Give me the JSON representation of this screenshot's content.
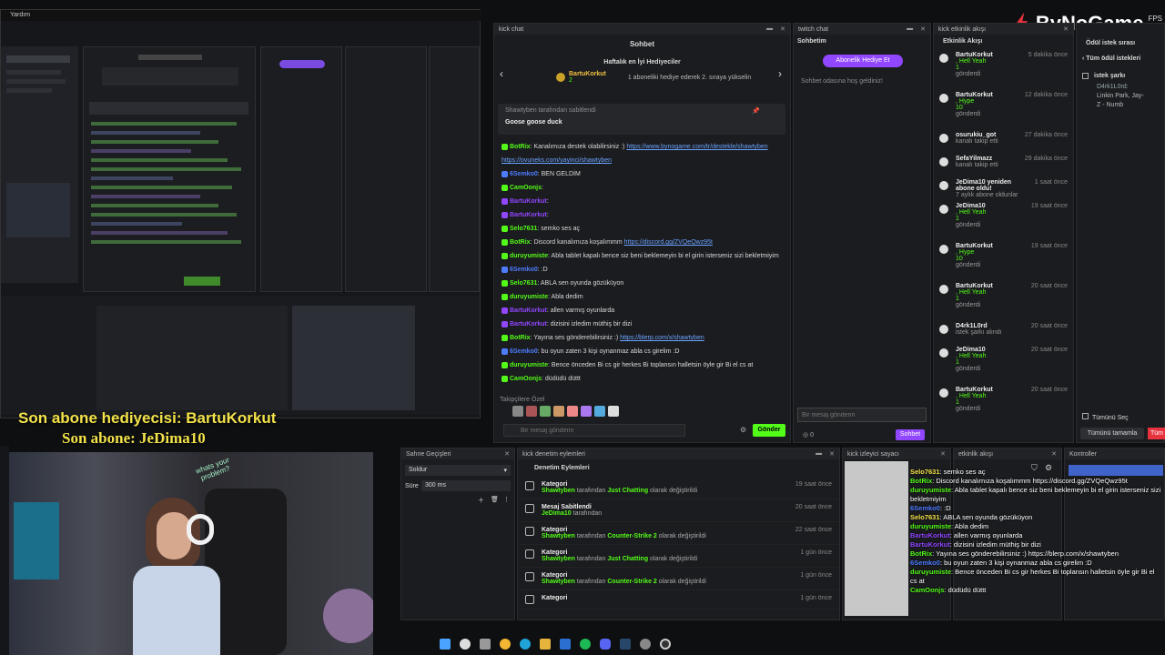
{
  "left_menu": {
    "item": "Yardım"
  },
  "brand": {
    "logo": "ByNoGame",
    "fps": "FPS",
    "accent": "#e8333f"
  },
  "kick_chat": {
    "title": "kick chat",
    "header": "Sohbet",
    "top_gifters_label": "Haftalık en İyi Hediyeciler",
    "top_gifter_name": "BartuKorkut",
    "top_gifter_count": "2",
    "top_gifter_note": "1 aboneliki hediye ederek 2. sıraya yükselin",
    "pinned_by": "Shawtyben tarafından sabitlendi",
    "pinned_message": "Goose goose duck",
    "messages": [
      {
        "user": "BotRix",
        "color": "#53fc18",
        "text": ": Kanalımıza destek olabilirsiniz :) ",
        "link": "https://www.bynogame.com/tr/destekle/shawtyben"
      },
      {
        "user": "",
        "color": "#6aa3ff",
        "text": "",
        "link": "https://ovuneks.com/yayinci/shawtyben"
      },
      {
        "user": "6Semko0",
        "color": "#4d7cff",
        "text": ": BEN GELDİM",
        "link": ""
      },
      {
        "user": "CamOonjs",
        "color": "#53fc18",
        "text": ": ",
        "link": ""
      },
      {
        "user": "BartuKorkut",
        "color": "#9146ff",
        "text": ": ",
        "link": ""
      },
      {
        "user": "BartuKorkut",
        "color": "#9146ff",
        "text": ": ",
        "link": ""
      },
      {
        "user": "Selo7631",
        "color": "#53fc18",
        "text": ": semko ses aç",
        "link": ""
      },
      {
        "user": "BotRix",
        "color": "#53fc18",
        "text": ": Discord kanalımıza koşalımmm ",
        "link": "https://discord.gg/ZVQeQwz95t"
      },
      {
        "user": "duruyumiste",
        "color": "#53fc18",
        "text": ": Abla tablet kapalı bence siz beni beklemeyin bi el girin isterseniz sizi bekletmiyim",
        "link": ""
      },
      {
        "user": "6Semko0",
        "color": "#4d7cff",
        "text": ": :D",
        "link": ""
      },
      {
        "user": "Selo7631",
        "color": "#53fc18",
        "text": ": ABLA sen oyunda gözüküyon",
        "link": ""
      },
      {
        "user": "duruyumiste",
        "color": "#53fc18",
        "text": ": Abla dedim",
        "link": ""
      },
      {
        "user": "BartuKorkut",
        "color": "#9146ff",
        "text": ": allen varmış oyunlarda",
        "link": ""
      },
      {
        "user": "BartuKorkut",
        "color": "#9146ff",
        "text": ": dizisini izledim müthiş bir dizi",
        "link": ""
      },
      {
        "user": "BotRix",
        "color": "#53fc18",
        "text": ": Yayına ses gönderebilirsiniz :) ",
        "link": "https://blerp.com/x/shawtyben"
      },
      {
        "user": "6Semko0",
        "color": "#4d7cff",
        "text": ": bu oyun zaten 3 kişi oynanmaz abla cs girelim :D",
        "link": ""
      },
      {
        "user": "duruyumiste",
        "color": "#53fc18",
        "text": ": Bence önceden Bi cs gir herkes Bi toplansın halletsin öyle gir Bi el cs at",
        "link": ""
      },
      {
        "user": "CamOonjs",
        "color": "#53fc18",
        "text": ": düdüdü düttt",
        "link": ""
      }
    ],
    "emote_label": "Takipçilere Özel",
    "input_placeholder": "Bir mesaj gönderin",
    "send_label": "Gönder"
  },
  "twitch_chat": {
    "title": "twitch chat",
    "header": "Sohbetim",
    "gift_button": "Abonelik Hediye Et",
    "welcome": "Sohbet odasına hoş geldiniz!",
    "input_placeholder": "Bir mesaj gönderin",
    "points": "0",
    "send_label": "Sohbet"
  },
  "activity": {
    "title": "kick etkinlik akışı",
    "header": "Etkinlik Akışı",
    "events": [
      {
        "name": "BartuKorkut",
        "lines": [
          ", Hell Yeah",
          "1",
          "gönderdi"
        ],
        "time": "5 dakika önce"
      },
      {
        "name": "BartuKorkut",
        "lines": [
          ", Hype",
          "10",
          "gönderdi"
        ],
        "time": "12 dakika önce"
      },
      {
        "name": "osurukiu_got",
        "lines": [
          "kanalı takip etti"
        ],
        "time": "27 dakika önce"
      },
      {
        "name": "SefaYilmazz",
        "lines": [
          "kanalı takip etti"
        ],
        "time": "29 dakika önce"
      },
      {
        "name": "JeDima10 yeniden abone oldu!",
        "lines": [
          "7 aylık abone oldunlar"
        ],
        "time": "1 saat önce"
      },
      {
        "name": "JeDima10",
        "lines": [
          ", Hell Yeah",
          "1",
          "gönderdi"
        ],
        "time": "19 saat önce"
      },
      {
        "name": "BartuKorkut",
        "lines": [
          ", Hype",
          "10",
          "gönderdi"
        ],
        "time": "19 saat önce"
      },
      {
        "name": "BartuKorkut",
        "lines": [
          ", Hell Yeah",
          "1",
          "gönderdi"
        ],
        "time": "20 saat önce"
      },
      {
        "name": "D4rk1L0rd",
        "lines": [
          "istek şarkı alındı"
        ],
        "time": "20 saat önce"
      },
      {
        "name": "JeDima10",
        "lines": [
          ", Hell Yeah",
          "1",
          "gönderdi"
        ],
        "time": "20 saat önce"
      },
      {
        "name": "BartuKorkut",
        "lines": [
          ", Hell Yeah",
          "1",
          "gönderdi"
        ],
        "time": "20 saat önce"
      }
    ]
  },
  "rewards": {
    "title": "Ödül istek sırası",
    "back_label": "Tüm ödül istekleri",
    "item_label": "istek şarkı",
    "item_user": "D4rk1L0rd:",
    "item_value": "Linkin Park, Jay-Z - Numb",
    "select_all": "Tümünü Seç",
    "complete_all": "Tümünü tamamla",
    "reject": "Tüm"
  },
  "overlay": {
    "last_gifter_label": "Son abone hediyecisi: BartuKorkut",
    "last_sub_label": "Son abone: JeDima10"
  },
  "scene_transitions": {
    "title": "Sahne Geçişleri",
    "transition": "Soldur",
    "duration_label": "Süre",
    "duration_value": "300 ms"
  },
  "mod_log": {
    "title": "kick denetim eylemleri",
    "header": "Denetim Eylemleri",
    "rows": [
      {
        "title": "Kategori",
        "user": "Shawtyben",
        "middle": " tarafından ",
        "target": "Just Chatting",
        "suffix": " olarak değiştirildi",
        "time": "19 saat önce"
      },
      {
        "title": "Mesaj Sabitlendi",
        "user": "JeDima10",
        "middle": " tarafından",
        "target": "",
        "suffix": "",
        "time": "20 saat önce"
      },
      {
        "title": "Kategori",
        "user": "Shawtyben",
        "middle": " tarafından ",
        "target": "Counter-Strike 2",
        "suffix": " olarak değiştirildi",
        "time": "22 saat önce"
      },
      {
        "title": "Kategori",
        "user": "Shawtyben",
        "middle": " tarafından ",
        "target": "Just Chatting",
        "suffix": " olarak değiştirildi",
        "time": "1 gün önce"
      },
      {
        "title": "Kategori",
        "user": "Shawtyben",
        "middle": " tarafından ",
        "target": "Counter-Strike 2",
        "suffix": " olarak değiştirildi",
        "time": "1 gün önce"
      },
      {
        "title": "Kategori",
        "user": "",
        "middle": "",
        "target": "",
        "suffix": "",
        "time": "1 gün önce"
      }
    ]
  },
  "viewer_count": {
    "title": "kick izleyici sayacı"
  },
  "activity2": {
    "title": "etkinlik akışı"
  },
  "controls": {
    "title": "Kontroller"
  },
  "overlay_chat": [
    {
      "user": "Selo7631",
      "text": ": semko ses aç"
    },
    {
      "user": "BotRix",
      "text": ": Discord kanalımıza koşalımmm https://discord.gg/ZVQeQwz95t"
    },
    {
      "user": "duruyumiste",
      "text": ": Abla tablet kapalı bence siz beni beklemeyin bi el girin isterseniz sizi bekletmiyim"
    },
    {
      "user": "6Semko0",
      "text": ": :D"
    },
    {
      "user": "Selo7631",
      "text": ": ABLA sen oyunda gözüküyon"
    },
    {
      "user": "duruyumiste",
      "text": ": Abla dedim"
    },
    {
      "user": "BartuKorkut",
      "text": ": allen varmış oyunlarda"
    },
    {
      "user": "BartuKorkut",
      "text": ": dizisini izledim müthiş bir dizi"
    },
    {
      "user": "BotRix",
      "text": ": Yayına ses gönderebilirsiniz :) https://blerp.com/x/shawtyben"
    },
    {
      "user": "6Semko0",
      "text": ": bu oyun zaten 3 kişi oynanmaz abla cs girelim :D"
    },
    {
      "user": "duruyumiste",
      "text": ": Bence önceden Bi cs gir herkes Bi toplansın halletsin öyle gir Bi el cs at"
    },
    {
      "user": "CamOonjs",
      "text": ": düdüdü düttt"
    }
  ],
  "webcam": {
    "sticker": "whats your problem?"
  },
  "taskbar": {
    "icons": [
      "windows-icon",
      "search-icon",
      "files-icon",
      "chrome-icon",
      "edge-icon",
      "explorer-icon",
      "mail-icon",
      "spotify-icon",
      "discord-icon",
      "steam-icon",
      "settings-icon",
      "obs-icon"
    ]
  }
}
